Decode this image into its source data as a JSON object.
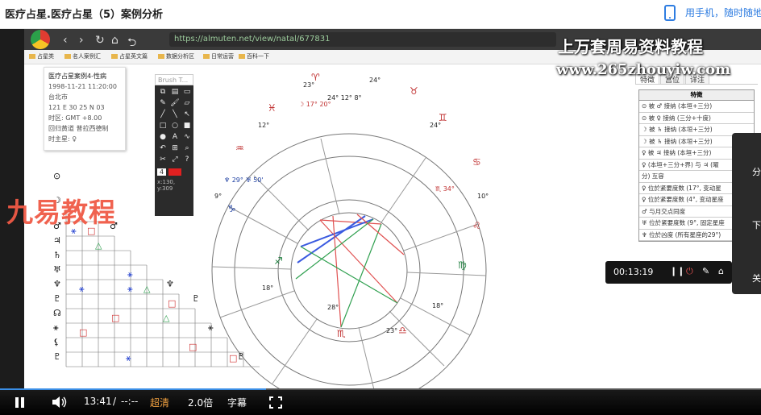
{
  "page_title": "医疗占星.医疗占星（5）案例分析",
  "mobile_link": "用手机，随时随地",
  "browser": {
    "url": "https://almuten.net/view/natal/677831"
  },
  "favorites": [
    "占星类",
    "名人案例汇",
    "占星英文篇",
    "数据分析区",
    "日常运营",
    "百科一下"
  ],
  "watermarks": {
    "line1": "上万套周易资料教程",
    "line2": "www.265zhouyiw.com",
    "line3": "九易教程"
  },
  "chart_info": {
    "name": "医疗占星案例4-性病",
    "date": "1998-11-21 11:20:00",
    "place": "台北市",
    "coords": "121 E 30  25 N 03",
    "tz": "时区: GMT +8.00",
    "house": "回归黄道 普拉西德制",
    "ruler": "时主星: ♀"
  },
  "toolbar": {
    "title": "Brush T...",
    "size": "4",
    "coord": "x:130, y:309"
  },
  "panel": {
    "tabs": [
      "特徵",
      "宫位",
      "详注"
    ],
    "header": "特徵",
    "rows": [
      "⊙ 被 ♂ 接纳 (本垣+三分)",
      "⊙ 被 ♀ 接纳 (三分+十度)",
      "☽ 被 ♄ 接纳 (本垣+三分)",
      "☽ 被 ♄ 接纳 (本垣+三分)",
      "♀ 被 ♃ 接纳 (本垣+三分)",
      "♀ (本垣+三分+界) 与 ♃ (曜",
      "分) 互容",
      "♀ 位於紧要度数 (17°, 变动星",
      "♀ 位於紧要度数 (4°, 变动星座",
      "♂ 与月交点同度",
      "♅ 位於紧要度数 (9°, 固定星座",
      "♆ 位於凶度 (所有星座的29°)"
    ]
  },
  "float_labels": [
    "分",
    "下",
    "关"
  ],
  "timebox": {
    "time": "00:13:19"
  },
  "controls": {
    "time": "13:41",
    "sep": "/",
    "total": "--:--",
    "quality": "超清",
    "speed": "2.0倍",
    "subtitle": "字幕",
    "progress": 0.35
  },
  "colors": {
    "accent": "#2f7de1",
    "quality": "#f0a040",
    "progress": "#3a8ee6"
  },
  "icons": [
    "phone-icon",
    "play-pause-icon",
    "volume-icon",
    "fullscreen-icon",
    "brush-icon",
    "pen-icon",
    "close-icon"
  ]
}
